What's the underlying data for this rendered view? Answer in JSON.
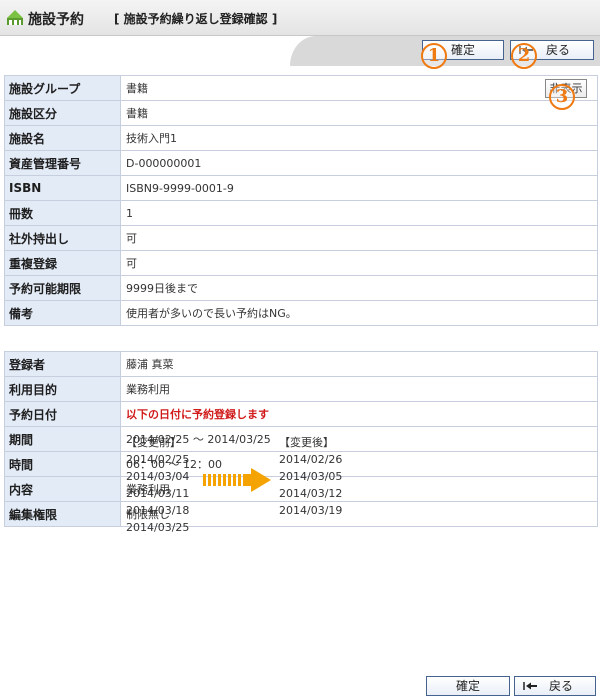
{
  "header": {
    "app_title": "施設予約",
    "page_title": "[ 施設予約繰り返し登録確認 ]"
  },
  "toolbar": {
    "confirm_label": "確定",
    "back_label": "戻る"
  },
  "markers": [
    "1",
    "2",
    "3"
  ],
  "facility": {
    "hide_label": "非表示",
    "rows": [
      {
        "label": "施設グループ",
        "value": "書籍"
      },
      {
        "label": "施設区分",
        "value": "書籍"
      },
      {
        "label": "施設名",
        "value": "技術入門1"
      },
      {
        "label": "資産管理番号",
        "value": "D-000000001"
      },
      {
        "label": "ISBN",
        "value": "ISBN9-9999-0001-9"
      },
      {
        "label": "冊数",
        "value": "1"
      },
      {
        "label": "社外持出し",
        "value": "可"
      },
      {
        "label": "重複登録",
        "value": "可"
      },
      {
        "label": "予約可能期限",
        "value": "9999日後まで"
      },
      {
        "label": "備考",
        "value": "使用者が多いので長い予約はNG。"
      }
    ]
  },
  "reservation": {
    "registrant_label": "登録者",
    "registrant_value": "藤浦 真菜",
    "purpose_label": "利用目的",
    "purpose_value": "業務利用",
    "date_label": "予約日付",
    "date_notice": "以下の日付に予約登録します",
    "before_header": "【変更前】",
    "after_header": "【変更後】",
    "before_dates": [
      "2014/02/25",
      "2014/03/04",
      "2014/03/11",
      "2014/03/18",
      "2014/03/25"
    ],
    "after_dates": [
      "2014/02/26",
      "2014/03/05",
      "2014/03/12",
      "2014/03/19"
    ],
    "period_label": "期間",
    "period_value": "2014/02/25 ～ 2014/03/25",
    "time_label": "時間",
    "time_value": "06：00 ～ 12：00",
    "content_label": "内容",
    "content_value": "業務利用",
    "edit_label": "編集権限",
    "edit_value": "制限無し"
  },
  "colors": {
    "header_cell_bg": "#e3ebf7",
    "border": "#c7cede",
    "notice": "#d11b1b",
    "marker": "#f07a12",
    "arrow": "#f5a300"
  }
}
